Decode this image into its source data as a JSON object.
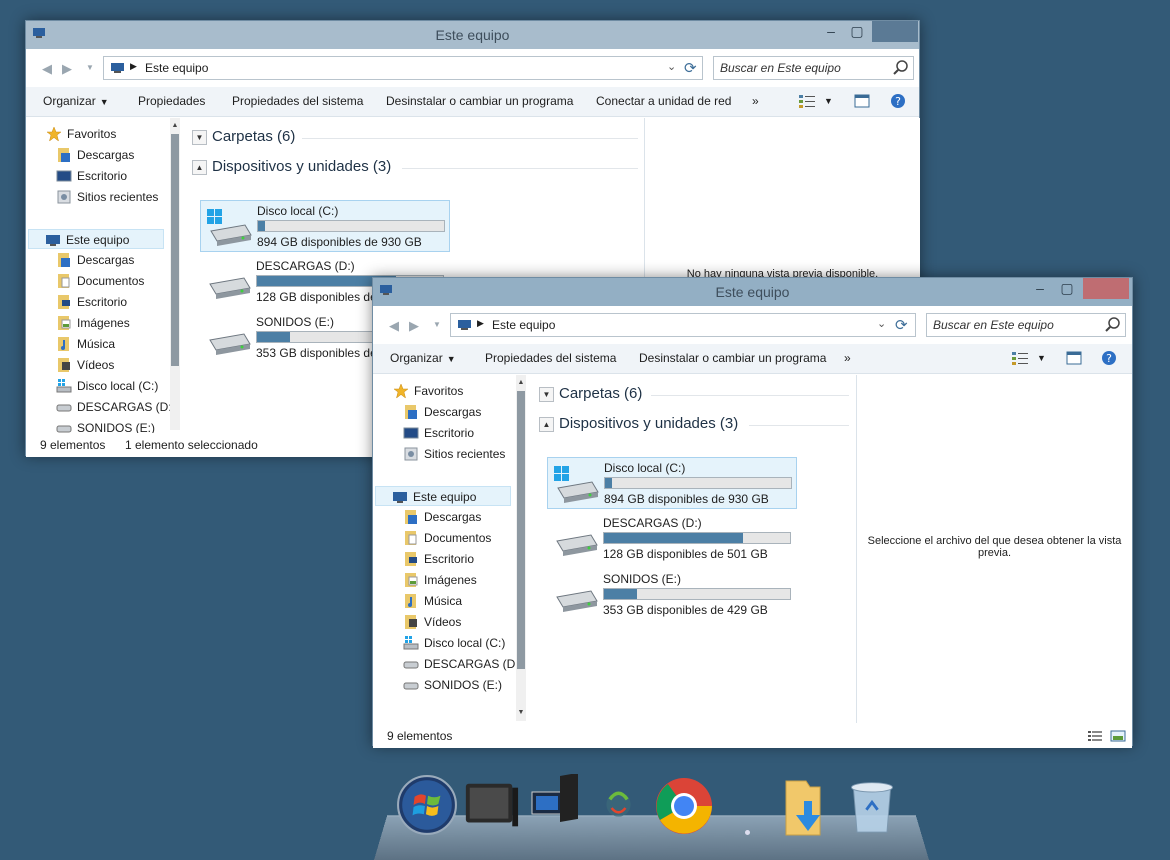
{
  "back_window": {
    "title": "Este equipo",
    "address": "Este equipo",
    "search_placeholder": "Buscar en Este equipo",
    "commands": [
      "Organizar",
      "Propiedades",
      "Propiedades del sistema",
      "Desinstalar o cambiar un programa",
      "Conectar a unidad de red",
      "»"
    ],
    "nav_items": [
      {
        "label": "Favoritos",
        "icon": "star-icon"
      },
      {
        "label": "Descargas",
        "icon": "downloads-folder-icon"
      },
      {
        "label": "Escritorio",
        "icon": "desktop-icon"
      },
      {
        "label": "Sitios recientes",
        "icon": "recent-places-icon"
      },
      {
        "label": "Este equipo",
        "icon": "computer-icon"
      },
      {
        "label": "Descargas",
        "icon": "downloads-folder-icon"
      },
      {
        "label": "Documentos",
        "icon": "documents-folder-icon"
      },
      {
        "label": "Escritorio",
        "icon": "desktop-folder-icon"
      },
      {
        "label": "Imágenes",
        "icon": "pictures-folder-icon"
      },
      {
        "label": "Música",
        "icon": "music-folder-icon"
      },
      {
        "label": "Vídeos",
        "icon": "videos-folder-icon"
      },
      {
        "label": "Disco local (C:)",
        "icon": "drive-c-icon"
      },
      {
        "label": "DESCARGAS (D:)",
        "icon": "drive-icon"
      },
      {
        "label": "SONIDOS (E:)",
        "icon": "drive-icon"
      }
    ],
    "groups": {
      "folders": "Carpetas (6)",
      "devices": "Dispositivos y unidades (3)"
    },
    "drives": [
      {
        "name": "Disco local (C:)",
        "free": "894 GB disponibles de 930 GB",
        "used_fraction": 0.039
      },
      {
        "name": "DESCARGAS (D:)",
        "free": "128 GB disponibles de 501 GB",
        "used_fraction": 0.745
      },
      {
        "name": "SONIDOS (E:)",
        "free": "353 GB disponibles de 429 GB",
        "used_fraction": 0.177
      }
    ],
    "preview_text": "No hay ninguna vista previa disponible.",
    "status": {
      "count": "9 elementos",
      "selected": "1 elemento seleccionado"
    }
  },
  "front_window": {
    "title": "Este equipo",
    "address": "Este equipo",
    "search_placeholder": "Buscar en Este equipo",
    "commands": [
      "Organizar",
      "Propiedades del sistema",
      "Desinstalar o cambiar un programa",
      "»"
    ],
    "nav_items": [
      {
        "label": "Favoritos",
        "icon": "star-icon"
      },
      {
        "label": "Descargas",
        "icon": "downloads-folder-icon"
      },
      {
        "label": "Escritorio",
        "icon": "desktop-icon"
      },
      {
        "label": "Sitios recientes",
        "icon": "recent-places-icon"
      },
      {
        "label": "Este equipo",
        "icon": "computer-icon"
      },
      {
        "label": "Descargas",
        "icon": "downloads-folder-icon"
      },
      {
        "label": "Documentos",
        "icon": "documents-folder-icon"
      },
      {
        "label": "Escritorio",
        "icon": "desktop-folder-icon"
      },
      {
        "label": "Imágenes",
        "icon": "pictures-folder-icon"
      },
      {
        "label": "Música",
        "icon": "music-folder-icon"
      },
      {
        "label": "Vídeos",
        "icon": "videos-folder-icon"
      },
      {
        "label": "Disco local (C:)",
        "icon": "drive-c-icon"
      },
      {
        "label": "DESCARGAS (D:)",
        "icon": "drive-icon"
      },
      {
        "label": "SONIDOS (E:)",
        "icon": "drive-icon"
      }
    ],
    "groups": {
      "folders": "Carpetas (6)",
      "devices": "Dispositivos y unidades (3)"
    },
    "drives": [
      {
        "name": "Disco local (C:)",
        "free": "894 GB disponibles de 930 GB",
        "used_fraction": 0.039
      },
      {
        "name": "DESCARGAS (D:)",
        "free": "128 GB disponibles de 501 GB",
        "used_fraction": 0.745
      },
      {
        "name": "SONIDOS (E:)",
        "free": "353 GB disponibles de 429 GB",
        "used_fraction": 0.177
      }
    ],
    "preview_text": "Seleccione el archivo del que desea obtener la vista previa.",
    "status": {
      "count": "9 elementos"
    }
  },
  "dock": {
    "icons": [
      "windows-start-icon",
      "computer-monitor-icon",
      "this-pc-icon",
      "network-icon",
      "chrome-icon",
      "downloads-folder-icon",
      "recycle-bin-icon"
    ]
  },
  "colors": {
    "desktop": "#335a77",
    "bar_fill": "#4c7fa5",
    "selection": "#e5f3fb",
    "close_active": "#bf6d72"
  }
}
